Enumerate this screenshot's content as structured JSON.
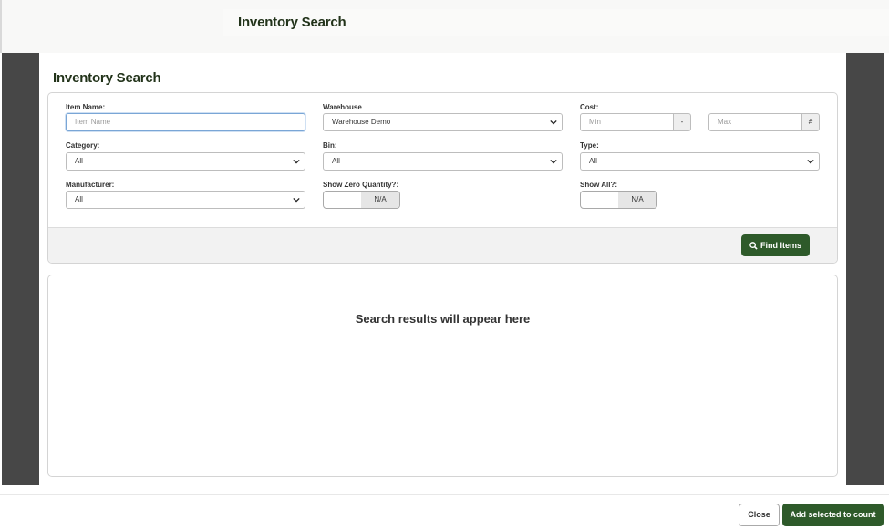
{
  "header": {
    "title": "Inventory Search"
  },
  "modal": {
    "title": "Inventory Search",
    "filters": {
      "item_name": {
        "label": "Item Name:",
        "placeholder": "Item Name",
        "value": ""
      },
      "warehouse": {
        "label": "Warehouse",
        "selected": "Warehouse Demo"
      },
      "cost": {
        "label": "Cost:",
        "min_placeholder": "Min",
        "min_addon": "-",
        "max_placeholder": "Max",
        "max_addon": "#"
      },
      "category": {
        "label": "Category:",
        "selected": "All"
      },
      "bin": {
        "label": "Bin:",
        "selected": "All"
      },
      "type": {
        "label": "Type:",
        "selected": "All"
      },
      "manufacturer": {
        "label": "Manufacturer:",
        "selected": "All"
      },
      "show_zero_quantity": {
        "label": "Show Zero Quantity?:",
        "value": "N/A"
      },
      "show_all": {
        "label": "Show All?:",
        "value": "N/A"
      }
    },
    "find_button": "Find Items",
    "results_placeholder": "Search results will appear here"
  },
  "footer": {
    "close_label": "Close",
    "add_label": "Add selected to count"
  },
  "colors": {
    "primary": "#2e5a2a",
    "backdrop": "#474747",
    "title_text": "#22331a"
  },
  "icons": {
    "find": "search-icon",
    "select": "chevron-down-icon"
  }
}
